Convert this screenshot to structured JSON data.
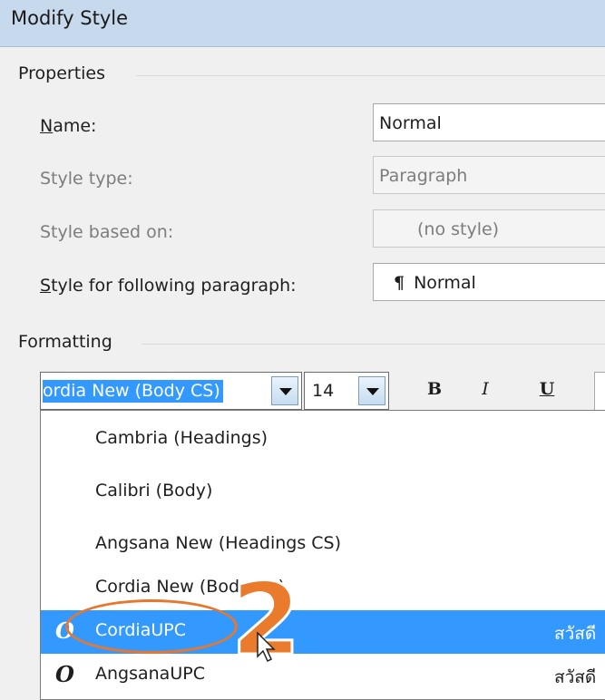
{
  "dialog": {
    "title": "Modify Style"
  },
  "properties": {
    "section_label": "Properties",
    "name_label": "Name:",
    "name_value": "Normal",
    "style_type_label": "Style type:",
    "style_type_value": "Paragraph",
    "based_on_label": "Style based on:",
    "based_on_value": "(no style)",
    "following_label": "Style for following paragraph:",
    "following_value": "Normal",
    "following_icon": "paragraph-mark-icon"
  },
  "formatting": {
    "section_label": "Formatting",
    "font_value": "ordia New (Body CS)",
    "size_value": "14",
    "bold_label": "B",
    "italic_label": "I",
    "underline_label": "U"
  },
  "font_list": [
    {
      "name": "Cambria (Headings)"
    },
    {
      "name": "Calibri (Body)"
    },
    {
      "name": "Angsana New (Headings CS)"
    },
    {
      "name": "Cordia New (Body CS)"
    },
    {
      "name": "CordiaUPC",
      "sample": "สวัสดี",
      "icon": "opentype-font-icon",
      "selected": true
    },
    {
      "name": "AngsanaUPC",
      "sample": "สวัสดี",
      "icon": "opentype-font-icon"
    }
  ],
  "annotation": {
    "step_number": "2",
    "color": "#e8772e"
  },
  "colors": {
    "selection": "#3399ff",
    "titlebar": "#c7d9ec"
  }
}
